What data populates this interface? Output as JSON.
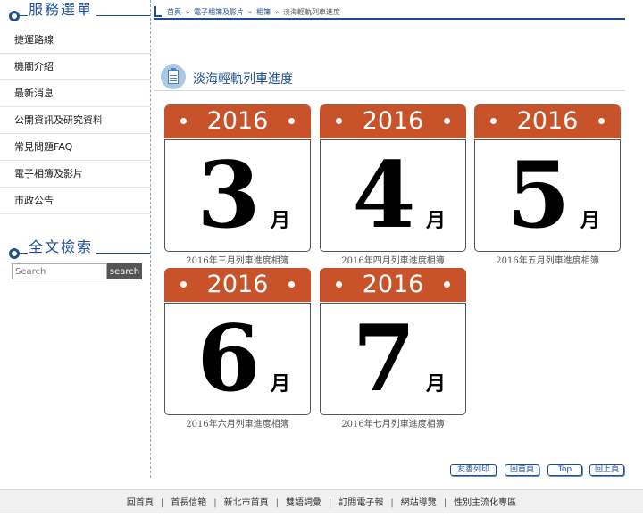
{
  "sidebar": {
    "title": "服務選單",
    "items": [
      {
        "label": "捷運路線"
      },
      {
        "label": "機關介紹"
      },
      {
        "label": "最新消息"
      },
      {
        "label": "公開資訊及研究資料"
      },
      {
        "label": "常見問題FAQ"
      },
      {
        "label": "電子相簿及影片"
      },
      {
        "label": "市政公告"
      }
    ],
    "search_title": "全文檢索",
    "search_placeholder": "Search",
    "search_button": "search"
  },
  "breadcrumb": {
    "items": [
      "首頁",
      "電子相簿及影片",
      "相簿"
    ],
    "separator": "»",
    "current": "淡海輕軌列車進度"
  },
  "page_title": "淡海輕軌列車進度",
  "albums": [
    {
      "year": "2016",
      "month": "3",
      "unit": "月",
      "caption": "2016年三月列車進度相簿"
    },
    {
      "year": "2016",
      "month": "4",
      "unit": "月",
      "caption": "2016年四月列車進度相簿"
    },
    {
      "year": "2016",
      "month": "5",
      "unit": "月",
      "caption": "2016年五月列車進度相簿"
    },
    {
      "year": "2016",
      "month": "6",
      "unit": "月",
      "caption": "2016年六月列車進度相簿"
    },
    {
      "year": "2016",
      "month": "7",
      "unit": "月",
      "caption": "2016年七月列車進度相簿"
    }
  ],
  "buttons": {
    "print": "友善列印",
    "home": "回首頁",
    "top": "Top",
    "back": "回上頁"
  },
  "footer": {
    "links": [
      "回首頁",
      "首長信箱",
      "新北市首頁",
      "雙語詞彙",
      "訂閱電子報",
      "網站導覽",
      "性別主流化專區"
    ],
    "separator": "|"
  },
  "colors": {
    "brand_blue": "#1d4f92",
    "calendar_red": "#c8532a"
  }
}
